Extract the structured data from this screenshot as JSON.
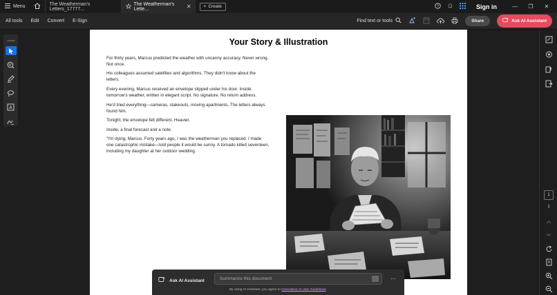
{
  "tabbar": {
    "menu_label": "Menu",
    "tabs": [
      {
        "label": "The Weatherman's Letters_17777..."
      },
      {
        "label": "The Weatherman's Lette..."
      }
    ],
    "create_label": "Create",
    "signin_label": "Sign in"
  },
  "toolbar": {
    "menu": [
      "All tools",
      "Edit",
      "Convert",
      "E-Sign"
    ],
    "find_label": "Find text or tools",
    "share_label": "Share",
    "ai_label": "Ask AI Assistant",
    "accent_color": "#e74b5d"
  },
  "left_rail": {
    "tools": [
      "select-cursor-icon",
      "comment-icon",
      "pen-icon",
      "lasso-icon",
      "text-box-icon",
      "signature-icon"
    ]
  },
  "right_rail": {
    "current_page": "1",
    "total_pages": "1"
  },
  "document": {
    "title": "Your Story & Illustration",
    "paragraphs": [
      "For thirty years, Marcus predicted the weather with uncanny accuracy. Never wrong. Not once.",
      "His colleagues assumed satellites and algorithms. They didn't know about the letters.",
      "Every evening, Marcus received an envelope slipped under his door. Inside: tomorrow's weather, written in elegant script. No signature. No return address.",
      "He'd tried everything—cameras, stakeouts, moving apartments. The letters always found him.",
      "Tonight, the envelope felt different. Heavier.",
      "Inside, a final forecast and a note:",
      "\"I'm dying, Marcus. Forty years ago, I was the weatherman you replaced. I made one catastrophic mistake—told people it would be sunny. A tornado killed seventeen, including my daughter at her outdoor wedding."
    ]
  },
  "ai_panel": {
    "title": "Ask AI Assistant",
    "placeholder": "Summarize this document",
    "disclaimer_prefix": "By using AI Assistant, you agree to ",
    "disclaimer_link": "Generative AI User Guidelines",
    "disclaimer_suffix": "."
  }
}
